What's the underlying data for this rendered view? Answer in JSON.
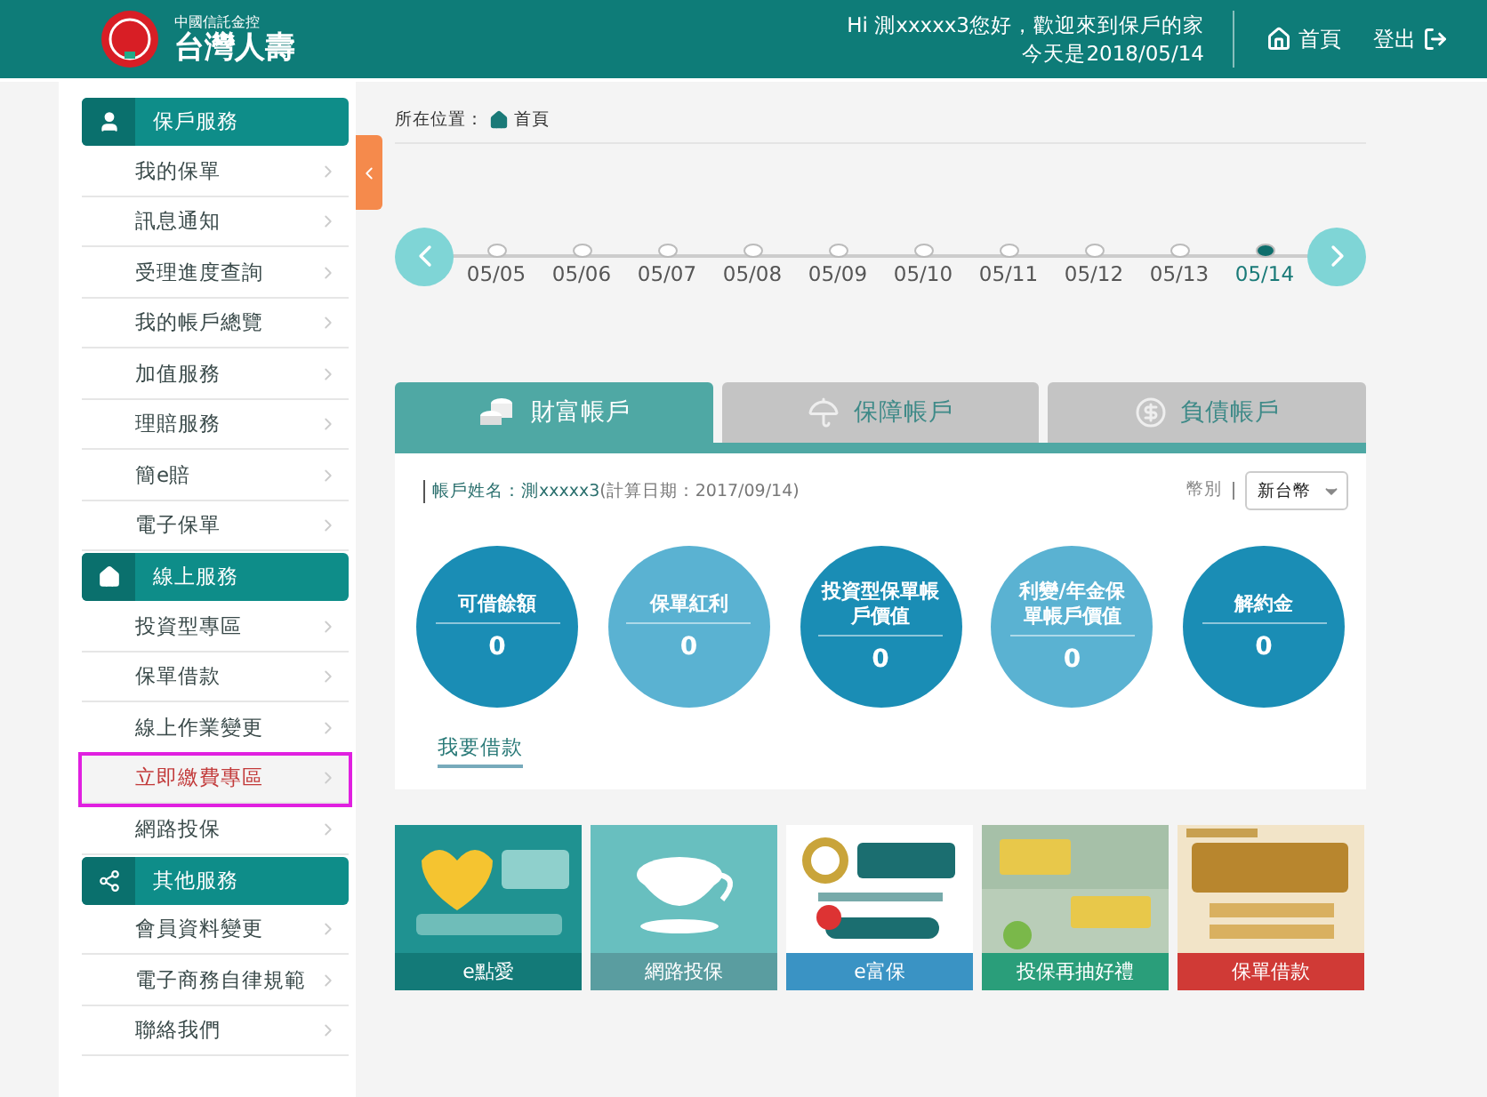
{
  "header": {
    "brand_small": "中國信託金控",
    "brand": "台灣人壽",
    "greeting": "Hi 測xxxxx3您好，歡迎來到保戶的家",
    "date": "今天是2018/05/14",
    "nav": [
      {
        "kind": "home",
        "label": "首頁"
      },
      {
        "kind": "logout",
        "label": "登出"
      }
    ]
  },
  "sidebar": [
    {
      "kind": "user",
      "title": "保戶服務",
      "items": [
        {
          "label": "我的保單",
          "highlighted": false
        },
        {
          "label": "訊息通知",
          "highlighted": false
        },
        {
          "label": "受理進度查詢",
          "highlighted": false
        },
        {
          "label": "我的帳戶總覽",
          "highlighted": false
        },
        {
          "label": "加值服務",
          "highlighted": false
        },
        {
          "label": "理賠服務",
          "highlighted": false
        },
        {
          "label": "簡e賠",
          "highlighted": false
        },
        {
          "label": "電子保單",
          "highlighted": false
        }
      ]
    },
    {
      "kind": "online",
      "title": "線上服務",
      "items": [
        {
          "label": "投資型專區",
          "highlighted": false
        },
        {
          "label": "保單借款",
          "highlighted": false
        },
        {
          "label": "線上作業變更",
          "highlighted": false
        },
        {
          "label": "立即繳費專區",
          "highlighted": true
        },
        {
          "label": "網路投保",
          "highlighted": false
        }
      ]
    },
    {
      "kind": "share",
      "title": "其他服務",
      "items": [
        {
          "label": "會員資料變更",
          "highlighted": false
        },
        {
          "label": "電子商務自律規範",
          "highlighted": false
        },
        {
          "label": "聯絡我們",
          "highlighted": false
        }
      ]
    }
  ],
  "breadcrumb": {
    "label": "所在位置：",
    "current": "首頁"
  },
  "timeline": [
    {
      "date": "05/05",
      "selected": false
    },
    {
      "date": "05/06",
      "selected": false
    },
    {
      "date": "05/07",
      "selected": false
    },
    {
      "date": "05/08",
      "selected": false
    },
    {
      "date": "05/09",
      "selected": false
    },
    {
      "date": "05/10",
      "selected": false
    },
    {
      "date": "05/11",
      "selected": false
    },
    {
      "date": "05/12",
      "selected": false
    },
    {
      "date": "05/13",
      "selected": false
    },
    {
      "date": "05/14",
      "selected": true
    }
  ],
  "tabs": [
    {
      "kind": "coins",
      "label": "財富帳戶",
      "selected": true
    },
    {
      "kind": "umbrella",
      "label": "保障帳戶",
      "selected": false
    },
    {
      "kind": "dollar",
      "label": "負債帳戶",
      "selected": false
    }
  ],
  "account": {
    "name_label": "帳戶姓名：",
    "name": "測xxxxx3",
    "calc_date": "(計算日期：2017/09/14)",
    "currency_label": "幣別",
    "currency": "新台幣"
  },
  "circles": [
    {
      "label": "可借餘額",
      "value": "0",
      "color": "#1a8db5"
    },
    {
      "label": "保單紅利",
      "value": "0",
      "color": "#5ab2d2"
    },
    {
      "label": "投資型保單帳戶價值",
      "value": "0",
      "color": "#1a8db5"
    },
    {
      "label": "利變/年金保單帳戶價值",
      "value": "0",
      "color": "#5ab2d2"
    },
    {
      "label": "解約金",
      "value": "0",
      "color": "#1a8db5"
    }
  ],
  "loan_link": "我要借款",
  "banners": [
    {
      "kind": "picture",
      "caption": "e點愛",
      "color": "#137a78"
    },
    {
      "kind": "picture",
      "caption": "網路投保",
      "color": "#5a9da0"
    },
    {
      "kind": "picture",
      "caption": "e富保",
      "color": "#3a93c4"
    },
    {
      "kind": "picture",
      "caption": "投保再抽好禮",
      "color": "#2a9e7a"
    },
    {
      "kind": "picture",
      "caption": "保單借款",
      "color": "#d03a36"
    }
  ]
}
